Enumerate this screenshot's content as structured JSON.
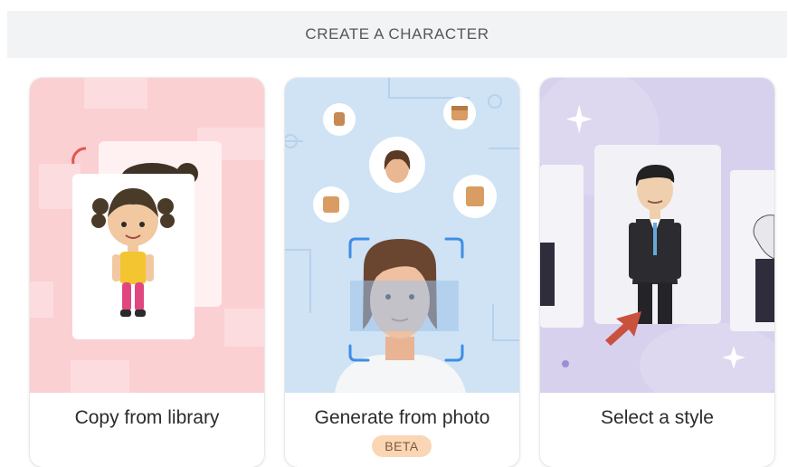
{
  "header": {
    "title": "CREATE A CHARACTER"
  },
  "cards": [
    {
      "label": "Copy from library"
    },
    {
      "label": "Generate from photo",
      "badge": "BETA"
    },
    {
      "label": "Select a style"
    }
  ],
  "colors": {
    "header_bg": "#f2f3f5",
    "card1_bg": "#fbd0d3",
    "card2_bg": "#cfe3f4",
    "card3_bg": "#d8d1ee",
    "beta_badge": "#fbd6b4",
    "scan_frame": "#3f8ee6",
    "arrow": "#c9523f"
  }
}
